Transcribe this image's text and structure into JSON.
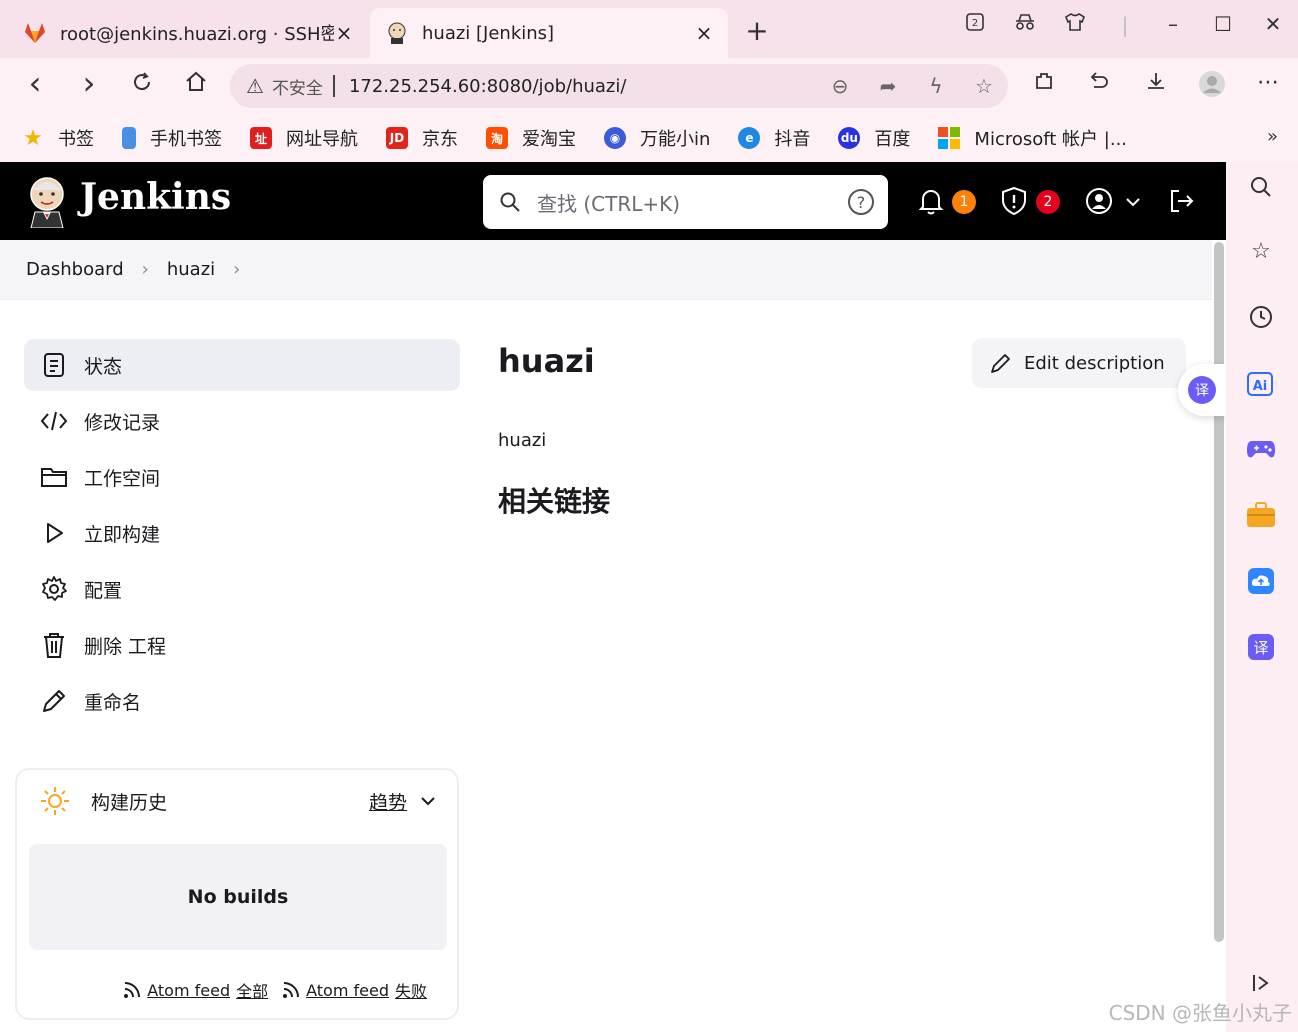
{
  "browser": {
    "tabs": [
      {
        "label": "root@jenkins.huazi.org · SSH密钥",
        "active": false,
        "icon": "gitlab-fox-icon"
      },
      {
        "label": "huazi [Jenkins]",
        "active": true,
        "icon": "jenkins-butler-icon"
      }
    ],
    "tab_close": "×",
    "new_tab": "+",
    "window_controls": [
      "–",
      "☐",
      "✕"
    ],
    "nav": {
      "back": "‹",
      "forward": "›"
    },
    "address": {
      "insecure_label": "不安全",
      "url": "172.25.254.60:8080/job/huazi/"
    },
    "bookmarks": [
      {
        "label": "书签",
        "icon": "star-icon",
        "color": "#f5b400"
      },
      {
        "label": "手机书签",
        "icon": "phone-icon",
        "color": "#4a90e2"
      },
      {
        "label": "网址导航",
        "icon": "nav-icon",
        "color": "#e02020"
      },
      {
        "label": "京东",
        "icon": "jd-icon",
        "color": "#e1251b"
      },
      {
        "label": "爱淘宝",
        "icon": "taobao-icon",
        "color": "#ff5000"
      },
      {
        "label": "万能小in",
        "icon": "bot-icon",
        "color": "#3b5bdb"
      },
      {
        "label": "抖音",
        "icon": "edge-icon",
        "color": "#1e88e5"
      },
      {
        "label": "百度",
        "icon": "baidu-icon",
        "color": "#2932e1"
      },
      {
        "label": "Microsoft 帐户 |...",
        "icon": "microsoft-icon",
        "color": "#f25022"
      }
    ],
    "bookmarks_more": "»",
    "watermark": "CSDN @张鱼小丸子"
  },
  "jenkins": {
    "brand": "Jenkins",
    "search_placeholder": "查找 (CTRL+K)",
    "help": "?",
    "notifications_count": "1",
    "security_count": "2",
    "breadcrumb": [
      "Dashboard",
      "huazi"
    ],
    "tasks": [
      {
        "label": "状态",
        "icon": "status-icon",
        "active": true
      },
      {
        "label": "修改记录",
        "icon": "code-icon",
        "active": false
      },
      {
        "label": "工作空间",
        "icon": "folder-icon",
        "active": false
      },
      {
        "label": "立即构建",
        "icon": "play-icon",
        "active": false
      },
      {
        "label": "配置",
        "icon": "gear-icon",
        "active": false
      },
      {
        "label": "删除 工程",
        "icon": "trash-icon",
        "active": false
      },
      {
        "label": "重命名",
        "icon": "pencil-icon",
        "active": false
      }
    ],
    "build_history": {
      "title": "构建历史",
      "trend": "趋势",
      "empty": "No builds",
      "feeds": [
        {
          "label": "Atom feed",
          "suffix": "全部"
        },
        {
          "label": "Atom feed",
          "suffix": "失败"
        }
      ]
    },
    "job": {
      "title": "huazi",
      "edit_description": "Edit description",
      "description": "huazi",
      "related_links": "相关链接"
    },
    "translate_badge": "译"
  },
  "colors": {
    "header_bg": "#000000",
    "badge_orange": "#fe820a",
    "badge_red": "#e6001f",
    "translate_purple": "#6b5cf6"
  }
}
